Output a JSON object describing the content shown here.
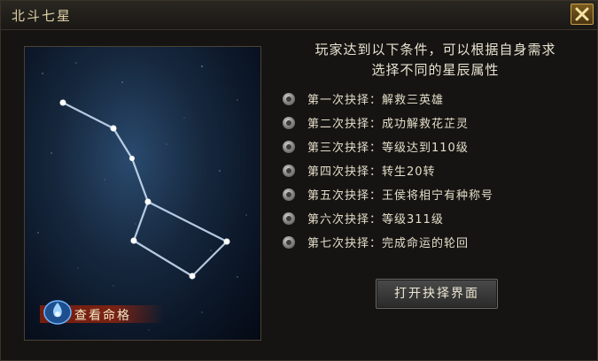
{
  "window": {
    "title": "北斗七星",
    "close_icon": "close-x-icon"
  },
  "intro_text": {
    "line1": "玩家达到以下条件，可以根据自身需求",
    "line2": "选择不同的星辰属性"
  },
  "conditions": [
    {
      "label": "第一次抉择：",
      "requirement": "解救三英雄"
    },
    {
      "label": "第二次抉择：",
      "requirement": "成功解救花芷灵"
    },
    {
      "label": "第三次抉择：",
      "requirement": "等级达到110级"
    },
    {
      "label": "第四次抉择：",
      "requirement": "转生20转"
    },
    {
      "label": "第五次抉择：",
      "requirement": "王侯将相宁有种称号"
    },
    {
      "label": "第六次抉择：",
      "requirement": "等级311级"
    },
    {
      "label": "第七次抉择：",
      "requirement": "完成命运的轮回"
    }
  ],
  "buttons": {
    "view_fate": "查看命格",
    "open_choice": "打开抉择界面"
  },
  "icons": {
    "bullet": "gray-orb-bullet-icon",
    "fate_emblem": "blue-flame-emblem-icon",
    "constellation": "big-dipper-constellation"
  },
  "colors": {
    "accent_gold": "#c9a24a",
    "text": "#e4ddca",
    "ribbon_red": "#8c230f"
  }
}
